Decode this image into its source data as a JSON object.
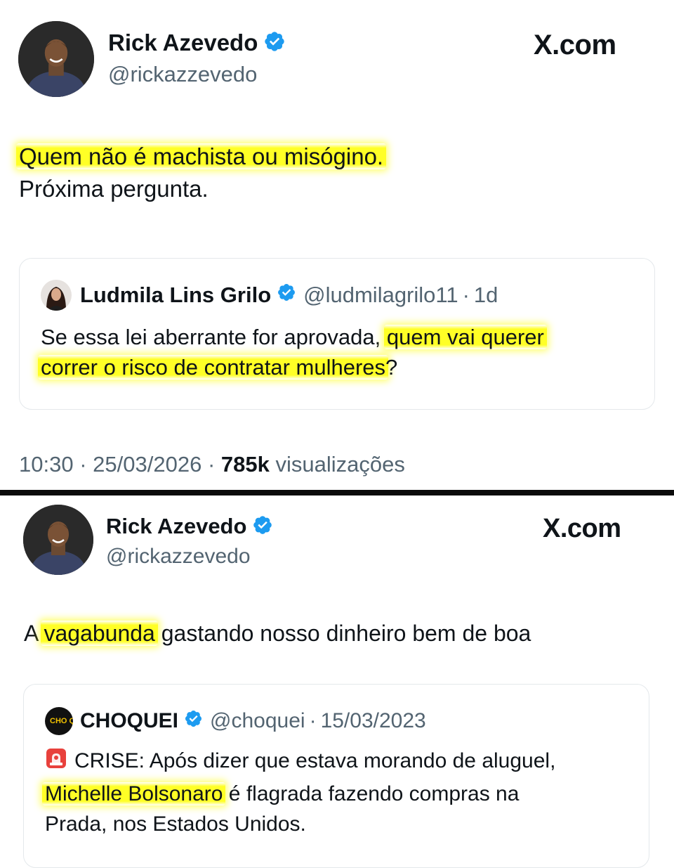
{
  "tweets": [
    {
      "author": {
        "name": "Rick Azevedo",
        "handle": "@rickazzevedo",
        "avatar": "avatar-man-photo"
      },
      "brand": "X.com",
      "text_lines": [
        {
          "highlight": "Quem não é machista ou misógino.",
          "rest": ""
        },
        {
          "highlight": "",
          "rest": "Próxima pergunta."
        }
      ],
      "quote": {
        "name": "Ludmila Lins Grilo",
        "handle": "@ludmilagrilo11",
        "separator": "·",
        "date": "1d",
        "text_plain": "Se essa lei aberrante for aprovada, ",
        "text_highlight_1": "quem vai querer",
        "text_highlight_2": "correr o risco de contratar mulheres",
        "text_end": "?"
      },
      "meta": {
        "time": "10:30",
        "sep1": "·",
        "date": "25/03/2026",
        "sep2": "·",
        "views": "785k",
        "views_label": "visualizações"
      }
    },
    {
      "author": {
        "name": "Rick Azevedo",
        "handle": "@rickazzevedo",
        "avatar": "avatar-man-photo"
      },
      "brand": "X.com",
      "text": {
        "prefix": "A ",
        "highlight": "vagabunda",
        "suffix": " gastando nosso dinheiro bem de boa"
      },
      "quote": {
        "name": "CHOQUEI",
        "handle": "@choquei",
        "separator": "·",
        "date": "15/03/2023",
        "logo_text": "CHO QUEI",
        "siren_icon": "siren-emoji-icon",
        "line1": "CRISE: Após dizer que estava morando de aluguel,",
        "highlight": "Michelle Bolsonaro",
        "line2_rest": " é flagrada fazendo compras na",
        "line3": "Prada, nos Estados Unidos."
      }
    }
  ],
  "colors": {
    "text": "#0f1419",
    "muted": "#536471",
    "verified": "#1d9bf0",
    "highlight": "#ffff00",
    "divider": "#0b0b0b"
  }
}
